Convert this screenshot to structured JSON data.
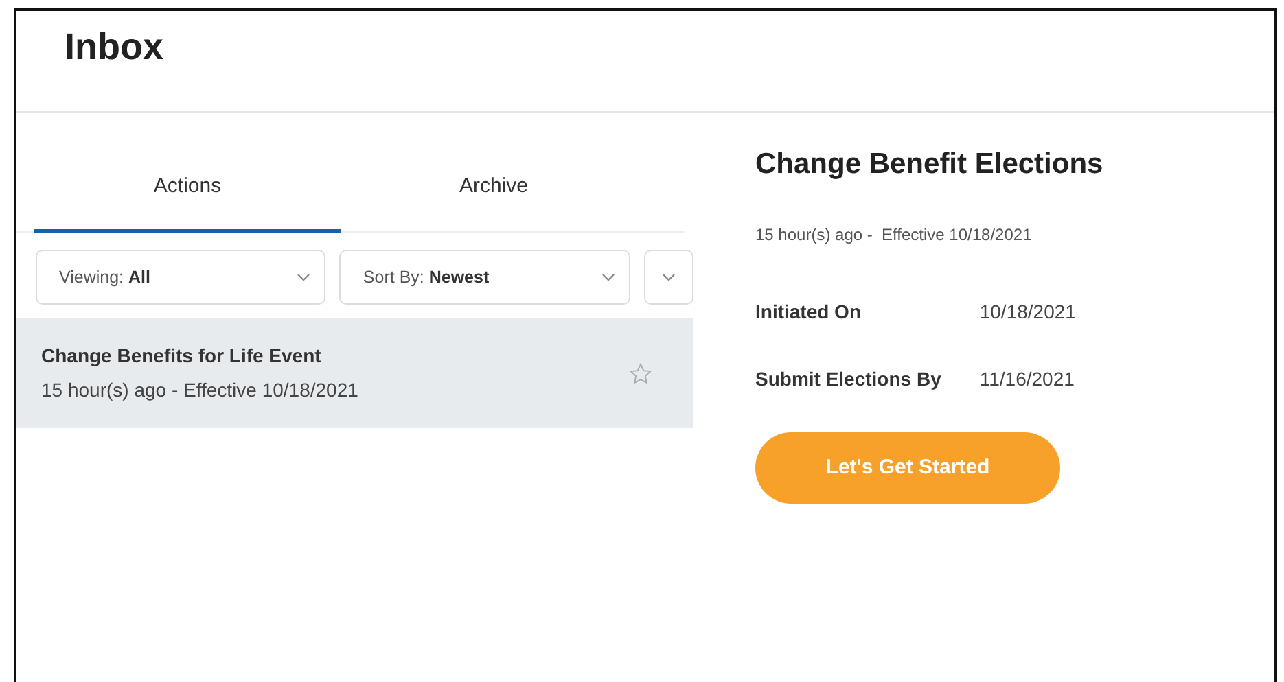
{
  "header": {
    "title": "Inbox"
  },
  "tabs": [
    {
      "label": "Actions",
      "selected": true
    },
    {
      "label": "Archive",
      "selected": false
    }
  ],
  "filters": [
    {
      "label": "Viewing: **All**"
    },
    {
      "label": "Sort By: **Newest**"
    }
  ],
  "items": [
    {
      "title": "Change Benefits for Life Event",
      "subtitle": "15 hour(s) ago - Effective 10/18/2021",
      "selected": true,
      "starred": false
    }
  ],
  "detail": {
    "title": "Change Benefit Elections",
    "subtitle": "15 hour(s) ago -  Effective 10/18/2021",
    "fields": [
      {
        "label": "Initiated On",
        "value": "10/18/2021"
      },
      {
        "label": "Submit Elections By",
        "value": "11/16/2021"
      }
    ],
    "button": "Let's Get Started"
  }
}
